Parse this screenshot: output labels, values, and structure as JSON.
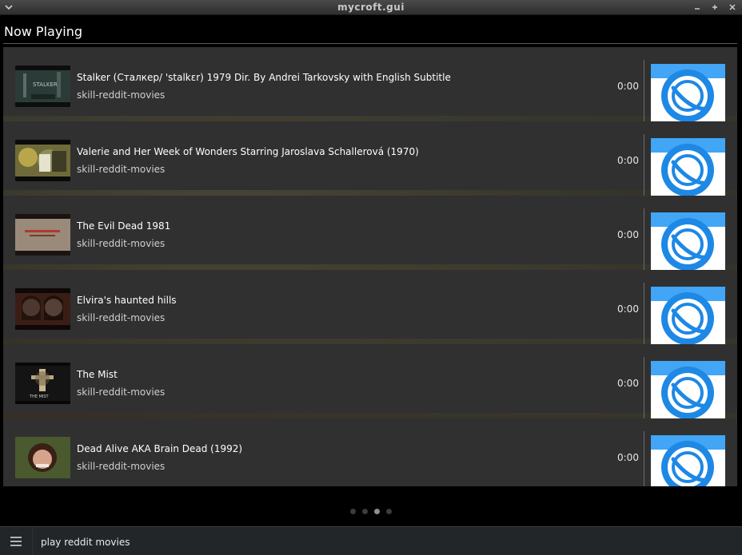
{
  "window": {
    "title": "mycroft.gui",
    "menu_icon": "chevron-down-icon",
    "controls": [
      "minimize-icon",
      "maximize-icon",
      "close-icon"
    ]
  },
  "header": {
    "title": "Now Playing"
  },
  "playlist": [
    {
      "title": "Stalker (Сталкер/ 'stalkɛr) 1979  Dir. By Andrei Tarkovsky  with English Subtitle",
      "source": "skill-reddit-movies",
      "duration": "0:00",
      "thumb_text": "STALKER"
    },
    {
      "title": "Valerie and Her Week of Wonders Starring Jaroslava Schallerová (1970)",
      "source": "skill-reddit-movies",
      "duration": "0:00"
    },
    {
      "title": "The Evil Dead 1981",
      "source": "skill-reddit-movies",
      "duration": "0:00"
    },
    {
      "title": "Elvira's haunted hills",
      "source": "skill-reddit-movies",
      "duration": "0:00"
    },
    {
      "title": "The Mist",
      "source": "skill-reddit-movies",
      "duration": "0:00",
      "thumb_text": "THE MIST"
    },
    {
      "title": "Dead Alive AKA Brain Dead (1992)",
      "source": "skill-reddit-movies",
      "duration": "0:00"
    }
  ],
  "skill_logo_icon": "reddit-planet-icon",
  "pager": {
    "count": 4,
    "active": 2
  },
  "bottom_bar": {
    "menu_icon": "hamburger-icon",
    "utterance": "play reddit movies"
  },
  "colors": {
    "row_bg": "#303030",
    "logo_blue": "#1e88e5",
    "logo_light_blue": "#42a5f5"
  }
}
